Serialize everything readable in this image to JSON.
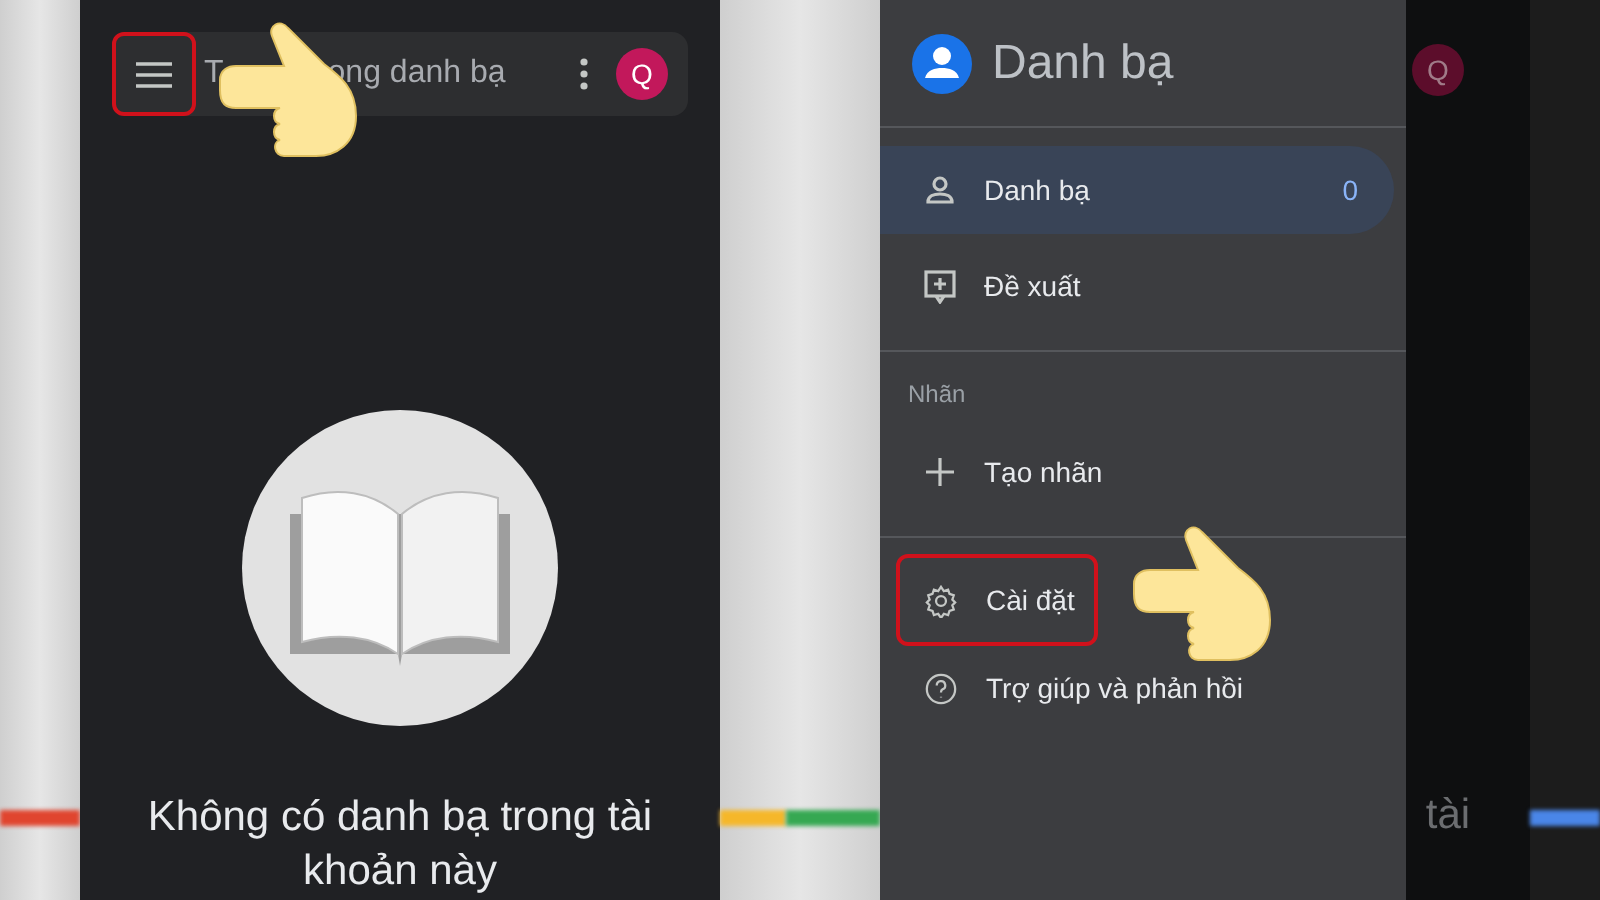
{
  "left_screen": {
    "menu_button": {
      "highlighted": true
    },
    "search_fragments": [
      "T",
      "ong danh bạ"
    ],
    "avatar": "Q",
    "empty_message": "Không có danh bạ trong tài khoản này"
  },
  "drawer": {
    "title": "Danh bạ",
    "items": [
      {
        "label": "Danh bạ",
        "count": "0",
        "selected": true
      },
      {
        "label": "Đề xuất",
        "selected": false
      }
    ],
    "section_label": "Nhãn",
    "label_items": [
      {
        "label": "Tạo nhãn",
        "selected": false
      }
    ],
    "footer_items": [
      {
        "label": "Cài đặt",
        "highlighted": true
      },
      {
        "label": "Trợ giúp và phản hồi",
        "highlighted": false
      }
    ]
  },
  "background_screen": {
    "avatar": "Q",
    "text": "tài"
  }
}
